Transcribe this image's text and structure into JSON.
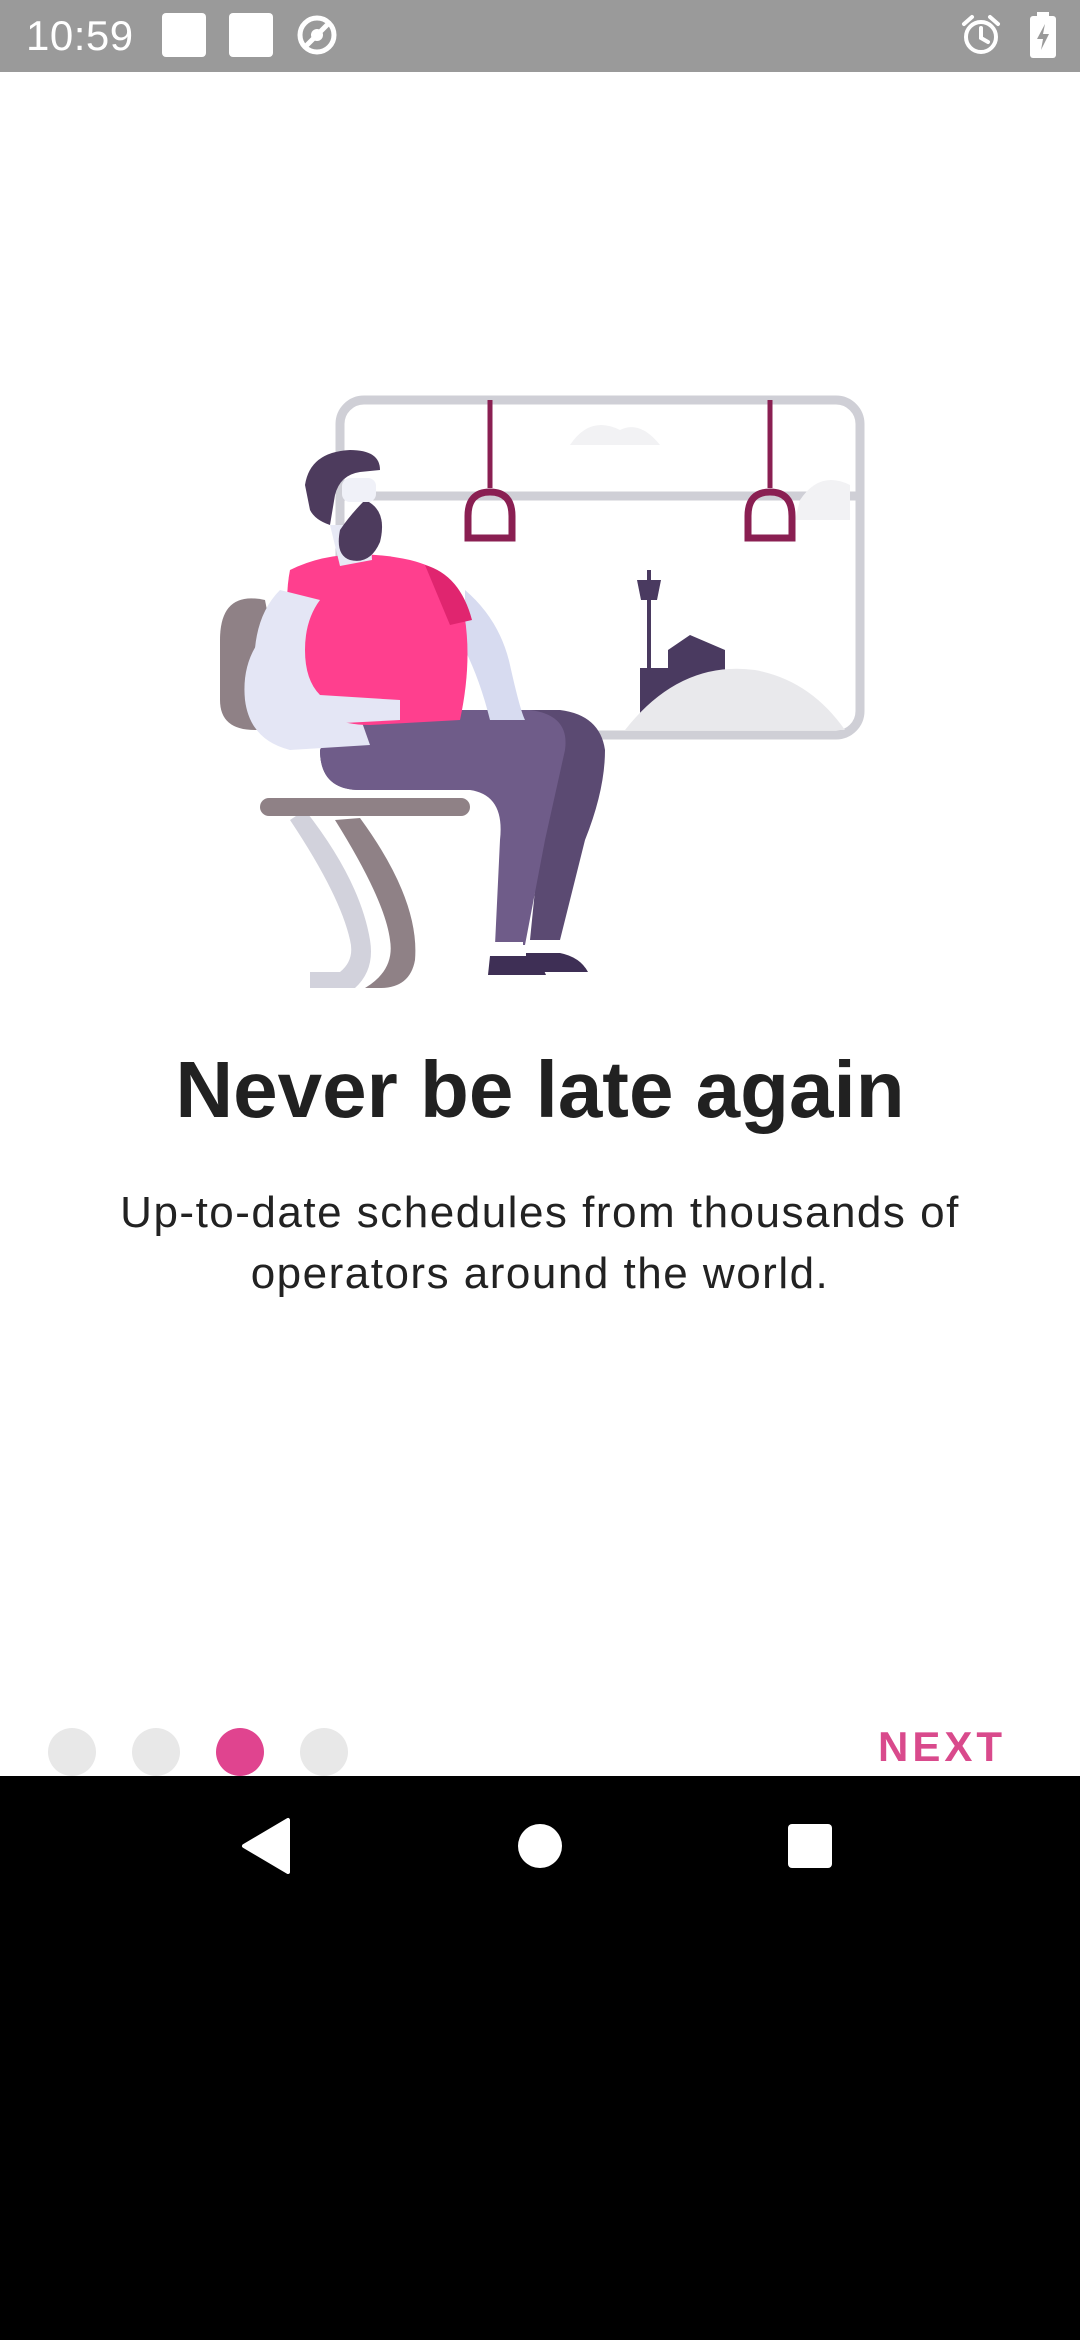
{
  "status_bar": {
    "time": "10:59",
    "icons": [
      "notification-square-icon",
      "notification-square-icon",
      "no-disturb-icon",
      "alarm-icon",
      "battery-charging-icon"
    ]
  },
  "onboarding": {
    "headline": "Never be late again",
    "subtitle": "Up-to-date schedules from thousands of operators around the world.",
    "page_indicator": {
      "total": 4,
      "active_index": 2
    },
    "next_label": "NEXT",
    "accent_color": "#e0448f"
  },
  "nav_bar": {
    "buttons": [
      "back-icon",
      "home-icon",
      "recents-icon"
    ]
  }
}
